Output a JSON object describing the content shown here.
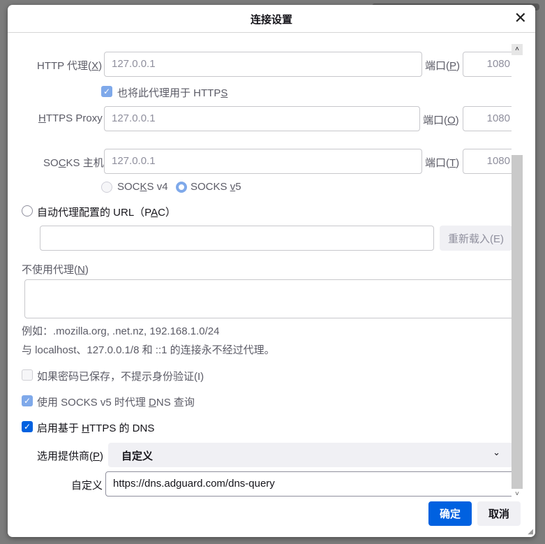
{
  "dialog": {
    "title": "连接设置",
    "close": "✕"
  },
  "http": {
    "label": "HTTP 代理(",
    "key": "X",
    "end": ")",
    "value": "127.0.0.1",
    "port_label": "端口(",
    "port_key": "P",
    "port_value": "1080"
  },
  "also_https": {
    "label": "也将此代理用于 HTTP",
    "key": "S",
    "checked": true
  },
  "https": {
    "key": "H",
    "label": "TTPS Proxy",
    "value": "127.0.0.1",
    "port_label": "端口(",
    "port_key": "O",
    "port_value": "1080"
  },
  "socks": {
    "label_a": "SO",
    "key": "C",
    "label_b": "KS 主机",
    "value": "127.0.0.1",
    "port_label": "端口(",
    "port_key": "T",
    "port_value": "1080"
  },
  "socks_v4": {
    "a": "SOC",
    "key": "K",
    "b": "S v4"
  },
  "socks_v5": {
    "a": "SOCKS ",
    "key": "v",
    "b": "5"
  },
  "pac": {
    "label_a": "自动代理配置的 URL（P",
    "key": "A",
    "label_b": "C）",
    "value": "",
    "reload_label": "重新载入(E)"
  },
  "no_proxy": {
    "label": "不使用代理(",
    "key": "N",
    "end": ")",
    "value": "",
    "example": "例如：.mozilla.org, .net.nz, 192.168.1.0/24",
    "note": "与 localhost、127.0.0.1/8 和 ::1 的连接永不经过代理。"
  },
  "no_auth": {
    "label": "如果密码已保存，不提示身份验证(I)",
    "checked": false
  },
  "socks_dns": {
    "a": "使用 SOCKS v5 时代理 ",
    "key": "D",
    "b": "NS 查询",
    "checked": true
  },
  "doh": {
    "a": "启用基于 ",
    "key": "H",
    "b": "TTPS 的 DNS",
    "checked": true
  },
  "provider": {
    "label": "选用提供商(",
    "key": "P",
    "end": ")",
    "value": "自定义"
  },
  "custom": {
    "label": "自定义",
    "value": "https://dns.adguard.com/dns-query"
  },
  "buttons": {
    "ok": "确定",
    "cancel": "取消"
  }
}
